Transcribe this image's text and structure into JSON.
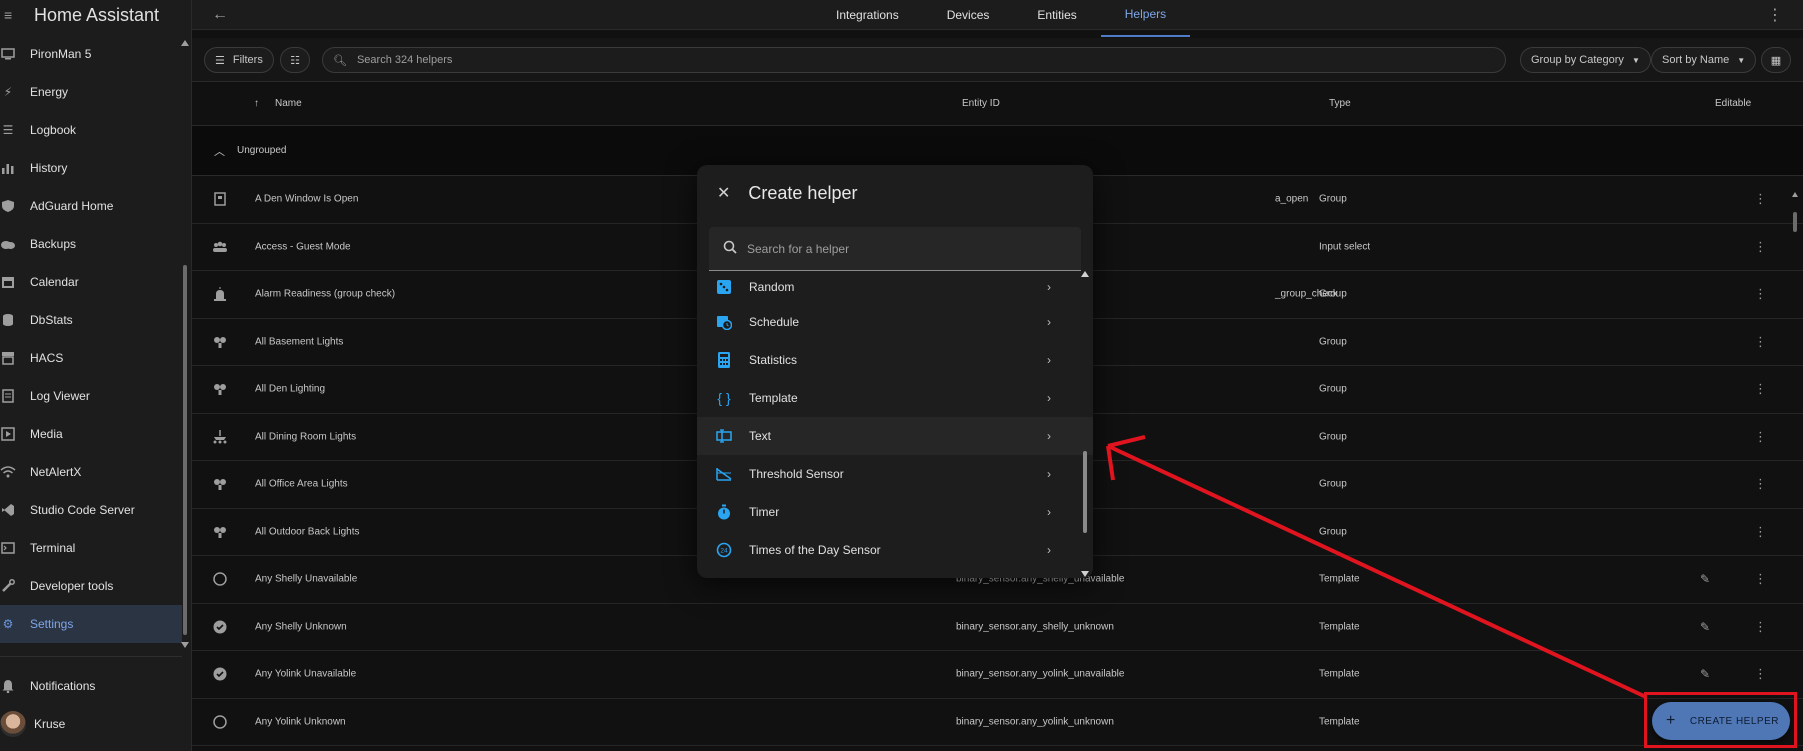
{
  "sidebar": {
    "title": "Home Assistant",
    "items": [
      {
        "label": "PironMan 5",
        "icon": "monitor-icon"
      },
      {
        "label": "Energy",
        "icon": "lightning-icon"
      },
      {
        "label": "Logbook",
        "icon": "list-icon"
      },
      {
        "label": "History",
        "icon": "chart-icon"
      },
      {
        "label": "AdGuard Home",
        "icon": "shield-icon"
      },
      {
        "label": "Backups",
        "icon": "cloud-icon"
      },
      {
        "label": "Calendar",
        "icon": "calendar-icon"
      },
      {
        "label": "DbStats",
        "icon": "database-icon"
      },
      {
        "label": "HACS",
        "icon": "store-icon"
      },
      {
        "label": "Log Viewer",
        "icon": "document-icon"
      },
      {
        "label": "Media",
        "icon": "media-icon"
      },
      {
        "label": "NetAlertX",
        "icon": "wifi-icon"
      },
      {
        "label": "Studio Code Server",
        "icon": "code-icon"
      },
      {
        "label": "Terminal",
        "icon": "terminal-icon"
      },
      {
        "label": "Developer tools",
        "icon": "wrench-icon"
      },
      {
        "label": "Settings",
        "icon": "gear-icon"
      }
    ],
    "notifications_label": "Notifications",
    "user_label": "Kruse"
  },
  "header": {
    "tabs": [
      {
        "label": "Integrations"
      },
      {
        "label": "Devices"
      },
      {
        "label": "Entities"
      },
      {
        "label": "Helpers"
      }
    ],
    "active_tab": "Helpers"
  },
  "toolbar": {
    "filters_label": "Filters",
    "search_placeholder": "Search 324 helpers",
    "group_by_label": "Group by Category",
    "sort_by_label": "Sort by Name"
  },
  "table": {
    "columns": {
      "name": "Name",
      "entity_id": "Entity ID",
      "type": "Type",
      "editable": "Editable"
    },
    "group_label": "Ungrouped",
    "rows": [
      {
        "name": "A Den Window Is Open",
        "entity": "a_open",
        "type": "Group",
        "icon": "door-icon",
        "editable": false
      },
      {
        "name": "Access - Guest Mode",
        "entity": "",
        "type": "Input select",
        "icon": "people-icon",
        "editable": false
      },
      {
        "name": "Alarm Readiness (group check)",
        "entity": "_group_check",
        "type": "Group",
        "icon": "alarm-light-icon",
        "editable": false
      },
      {
        "name": "All Basement Lights",
        "entity": "",
        "type": "Group",
        "icon": "lights-group-icon",
        "editable": false
      },
      {
        "name": "All Den Lighting",
        "entity": "",
        "type": "Group",
        "icon": "lights-group-icon",
        "editable": false
      },
      {
        "name": "All Dining Room Lights",
        "entity": "",
        "type": "Group",
        "icon": "chandelier-icon",
        "editable": false
      },
      {
        "name": "All Office Area Lights",
        "entity": "",
        "type": "Group",
        "icon": "lights-group-icon",
        "editable": false
      },
      {
        "name": "All Outdoor Back Lights",
        "entity": "",
        "type": "Group",
        "icon": "lights-group-icon",
        "editable": false
      },
      {
        "name": "Any Shelly Unavailable",
        "entity": "binary_sensor.any_shelly_unavailable",
        "type": "Template",
        "icon": "circle-outline-icon",
        "editable": true
      },
      {
        "name": "Any Shelly Unknown",
        "entity": "binary_sensor.any_shelly_unknown",
        "type": "Template",
        "icon": "check-circle-icon",
        "editable": true
      },
      {
        "name": "Any Yolink Unavailable",
        "entity": "binary_sensor.any_yolink_unavailable",
        "type": "Template",
        "icon": "check-circle-icon",
        "editable": true
      },
      {
        "name": "Any Yolink Unknown",
        "entity": "binary_sensor.any_yolink_unknown",
        "type": "Template",
        "icon": "circle-outline-icon",
        "editable": false
      }
    ]
  },
  "dialog": {
    "title": "Create helper",
    "search_placeholder": "Search for a helper",
    "items": [
      {
        "label": "Random",
        "icon": "dice-icon"
      },
      {
        "label": "Schedule",
        "icon": "calendar-clock-icon"
      },
      {
        "label": "Statistics",
        "icon": "calculator-icon"
      },
      {
        "label": "Template",
        "icon": "braces-icon"
      },
      {
        "label": "Text",
        "icon": "text-box-icon"
      },
      {
        "label": "Threshold Sensor",
        "icon": "threshold-icon"
      },
      {
        "label": "Timer",
        "icon": "timer-icon"
      },
      {
        "label": "Times of the Day Sensor",
        "icon": "clock-24-icon"
      }
    ],
    "hovered_item": "Text"
  },
  "fab": {
    "label": "CREATE HELPER"
  },
  "colors": {
    "accent": "#4f77b6",
    "annotation": "#e0141e",
    "dialog_icon": "#2aa5f2"
  }
}
